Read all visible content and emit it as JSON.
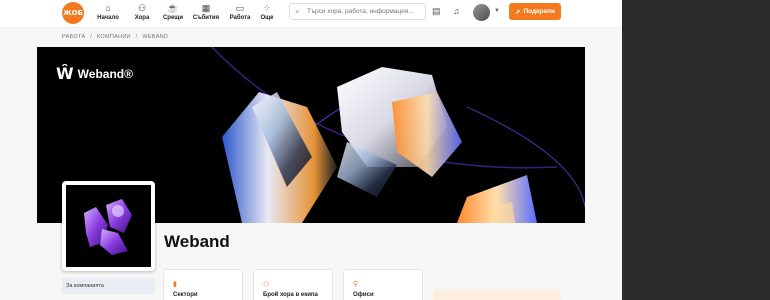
{
  "nav": {
    "logo_text": "ЖОБ",
    "items": [
      {
        "label": "Начало",
        "icon": "home-icon"
      },
      {
        "label": "Хора",
        "icon": "people-icon"
      },
      {
        "label": "Срещи",
        "icon": "coffee-icon"
      },
      {
        "label": "Събития",
        "icon": "calendar-icon"
      },
      {
        "label": "Работа",
        "icon": "briefcase-icon"
      },
      {
        "label": "Още",
        "icon": "more-icon"
      }
    ],
    "search_placeholder": "Търси хора, работа, информация...",
    "support_label": "Подкрепи"
  },
  "breadcrumb": [
    "РАБОТА",
    "/",
    "КОМПАНИИ",
    "/",
    "WEBAND"
  ],
  "banner": {
    "brand": "Weband®"
  },
  "company": {
    "name": "Weband"
  },
  "sidebar": {
    "tab_label": "За компанията"
  },
  "cards": [
    {
      "label": "Сектори",
      "icon": "building-icon"
    },
    {
      "label": "Брой хора в екипа",
      "icon": "team-icon"
    },
    {
      "label": "Офиси",
      "icon": "location-icon"
    }
  ],
  "colors": {
    "accent": "#f47a20",
    "banner": "#000000",
    "dark_panel": "#2b2b2b"
  }
}
